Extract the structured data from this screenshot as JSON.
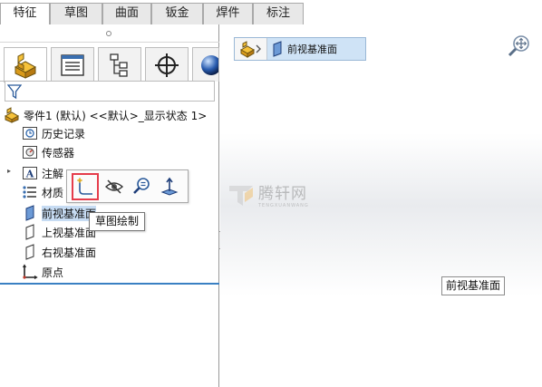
{
  "command_tabs": [
    {
      "label": "特征",
      "active": true
    },
    {
      "label": "草图",
      "active": false
    },
    {
      "label": "曲面",
      "active": false
    },
    {
      "label": "钣金",
      "active": false
    },
    {
      "label": "焊件",
      "active": false
    },
    {
      "label": "标注",
      "active": false
    }
  ],
  "manager_tabs": {
    "scroll_left": "◂",
    "scroll_right": "▸"
  },
  "tree": {
    "root": "零件1 (默认) <<默认>_显示状态 1>",
    "expander": "▸",
    "items": [
      {
        "label": "历史记录",
        "icon": "history-icon"
      },
      {
        "label": "传感器",
        "icon": "sensor-icon"
      },
      {
        "label": "注解",
        "icon": "annotation-icon"
      },
      {
        "label": "材质",
        "icon": "material-icon"
      },
      {
        "label": "前视基准面",
        "icon": "plane-icon",
        "selected": true
      },
      {
        "label": "上视基准面",
        "icon": "plane-icon"
      },
      {
        "label": "右视基准面",
        "icon": "plane-icon"
      },
      {
        "label": "原点",
        "icon": "origin-icon"
      }
    ]
  },
  "context_toolbar": {
    "tooltip": "草图绘制",
    "highlight_color": "#e53c4b"
  },
  "breadcrumb": {
    "label": "前视基准面"
  },
  "watermark": {
    "text": "腾轩网",
    "sub": "TENGXUANWANG"
  },
  "graphics": {
    "plane_label": "前视基准面"
  },
  "colors": {
    "selection": "#c7dcf3",
    "accent_blue": "#3a80c3",
    "breadcrumb_bg": "#cfe3f6"
  }
}
